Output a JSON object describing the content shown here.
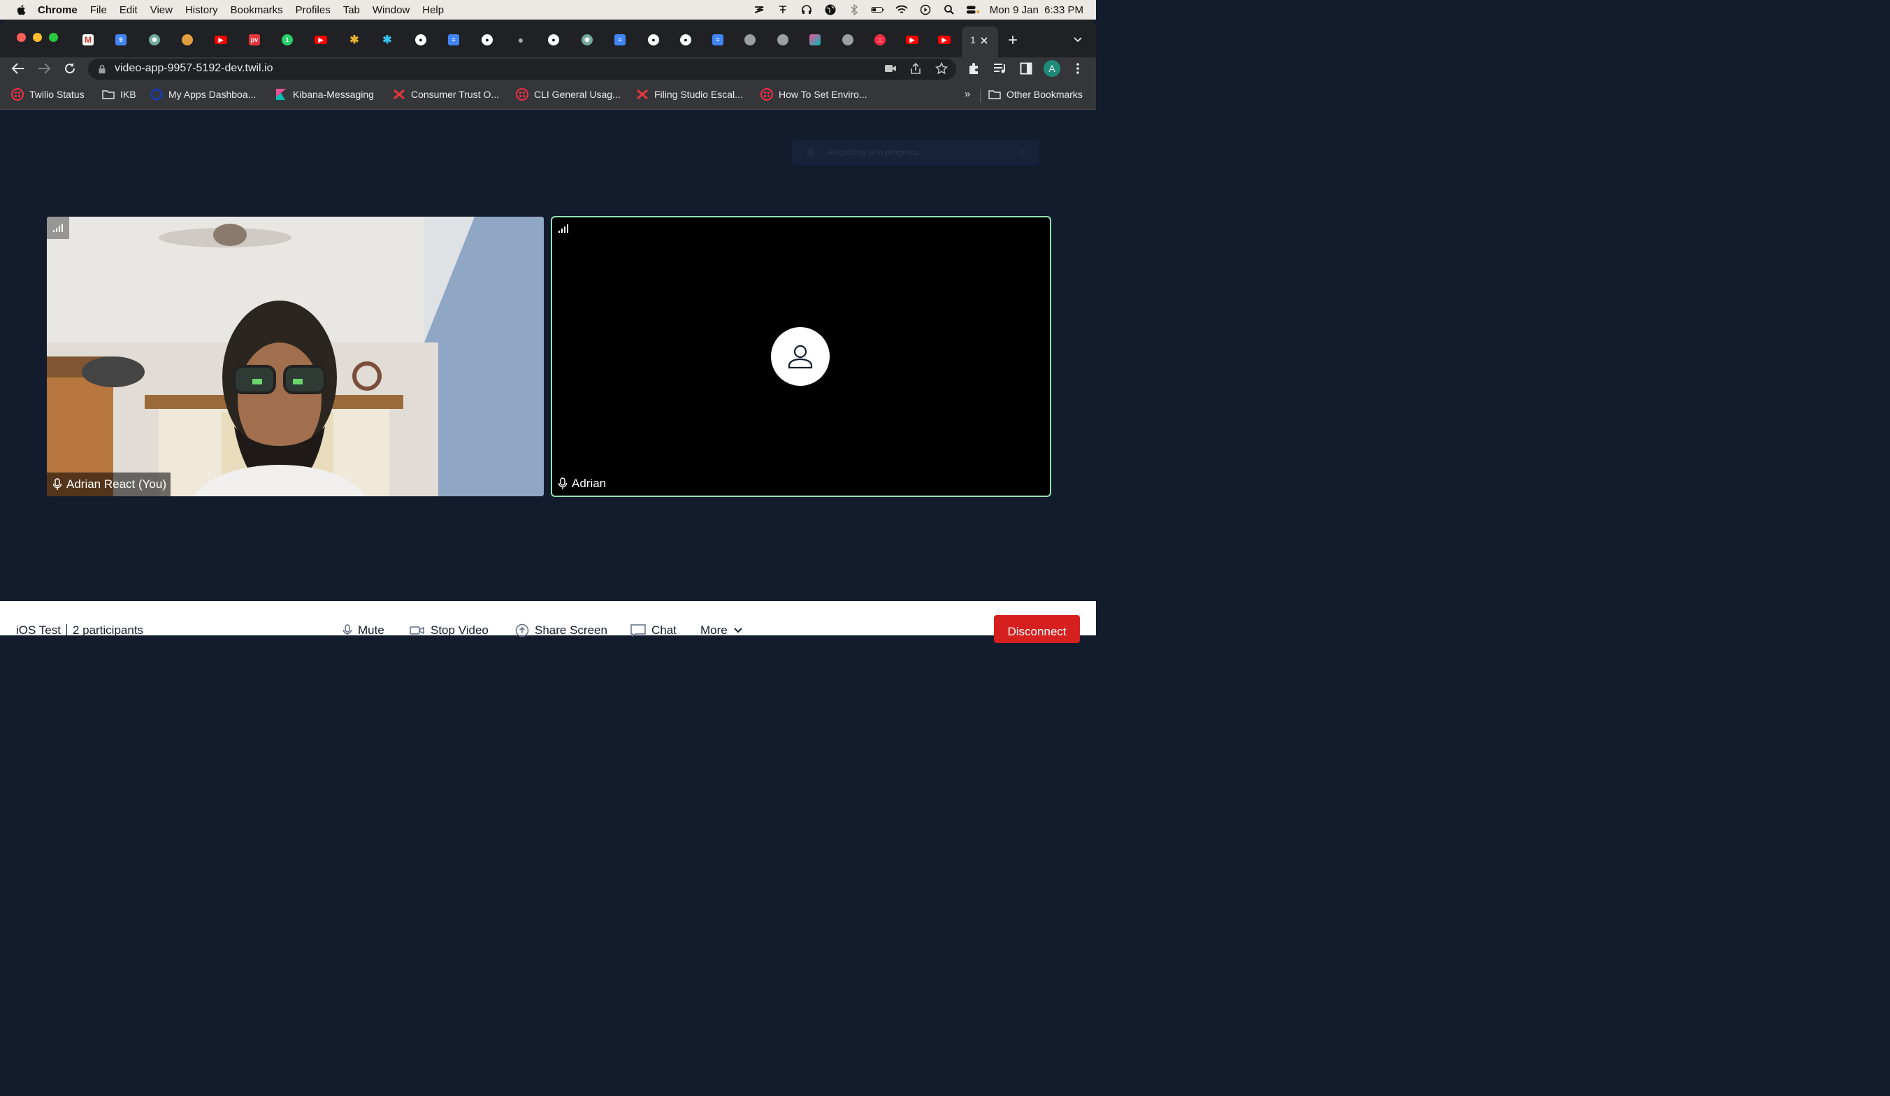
{
  "menubar": {
    "app": "Chrome",
    "items": [
      "File",
      "Edit",
      "View",
      "History",
      "Bookmarks",
      "Profiles",
      "Tab",
      "Window",
      "Help"
    ],
    "datetime": "Mon 9 Jan  6:33 PM"
  },
  "tabs": {
    "active_label": "1",
    "new_tab": "+"
  },
  "toolbar": {
    "url": "video-app-9957-5192-dev.twil.io",
    "profile_initial": "A"
  },
  "bookmarks": {
    "items": [
      "Twilio Status",
      "IKB",
      "My Apps Dashboa...",
      "Kibana-Messaging",
      "Consumer Trust O...",
      "CLI General Usag...",
      "Filing Studio Escal...",
      "How To Set Enviro..."
    ],
    "overflow": "»",
    "other": "Other Bookmarks"
  },
  "toast": {
    "text": "Recording is in progress."
  },
  "participants": {
    "local_name": "Adrian React (You)",
    "remote_name": "Adrian"
  },
  "controls": {
    "room_name": "iOS Test",
    "participant_count": "2 participants",
    "mute": "Mute",
    "stop_video": "Stop Video",
    "share_screen": "Share Screen",
    "chat": "Chat",
    "more": "More",
    "disconnect": "Disconnect"
  },
  "colors": {
    "background": "#121c2d",
    "dominant_speaker_border": "#94e3b0",
    "disconnect": "#d6201f"
  }
}
